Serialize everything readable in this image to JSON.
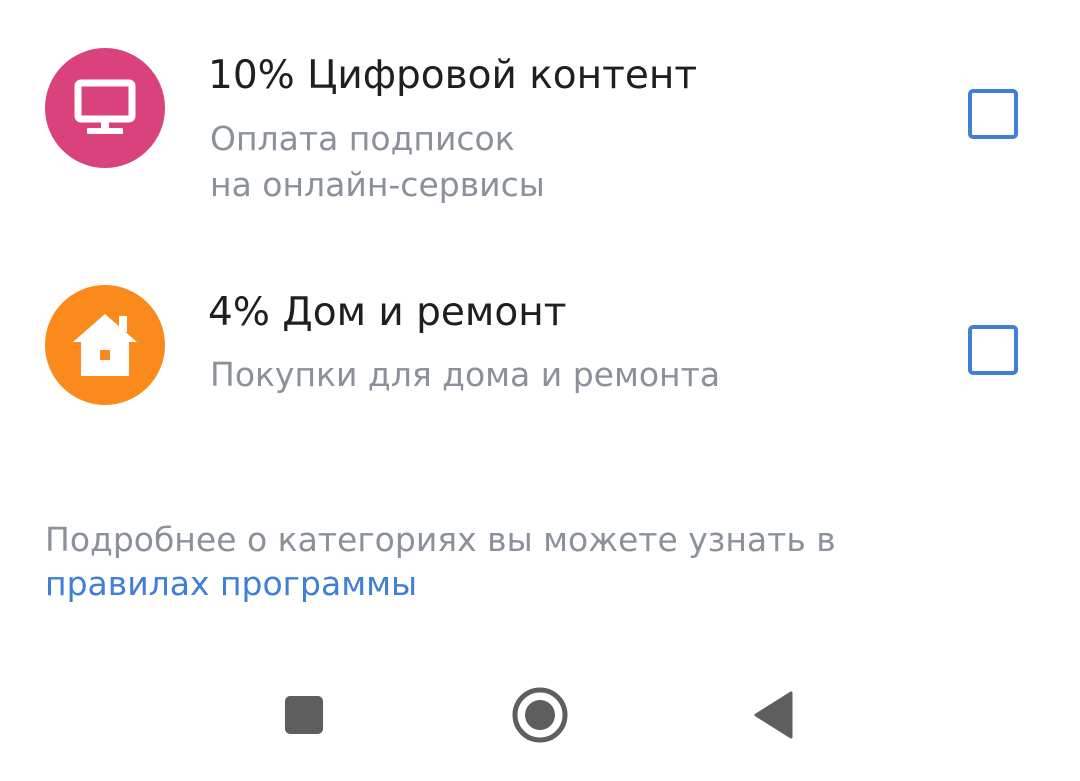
{
  "categories": [
    {
      "title": "10% Цифровой контент",
      "description": "Оплата подписок\nна онлайн-сервисы",
      "description_lines": [
        "Оплата подписок",
        "на онлайн-сервисы"
      ],
      "icon": "monitor-icon",
      "icon_color": "#d9427a",
      "checked": false
    },
    {
      "title": "4% Дом и ремонт",
      "description_lines": [
        "Покупки для дома и ремонта"
      ],
      "icon": "house-icon",
      "icon_color": "#f98a1b",
      "checked": false
    }
  ],
  "info": {
    "text": "Подробнее о категориях вы можете узнать в",
    "link": "правилах программы"
  },
  "navbar": {
    "icons": [
      "recents-square-icon",
      "home-circle-icon",
      "back-triangle-icon"
    ]
  },
  "colors": {
    "accent": "#3f7fd6",
    "secondary_text": "#8a919a",
    "primary_text": "#1f1f1f"
  }
}
